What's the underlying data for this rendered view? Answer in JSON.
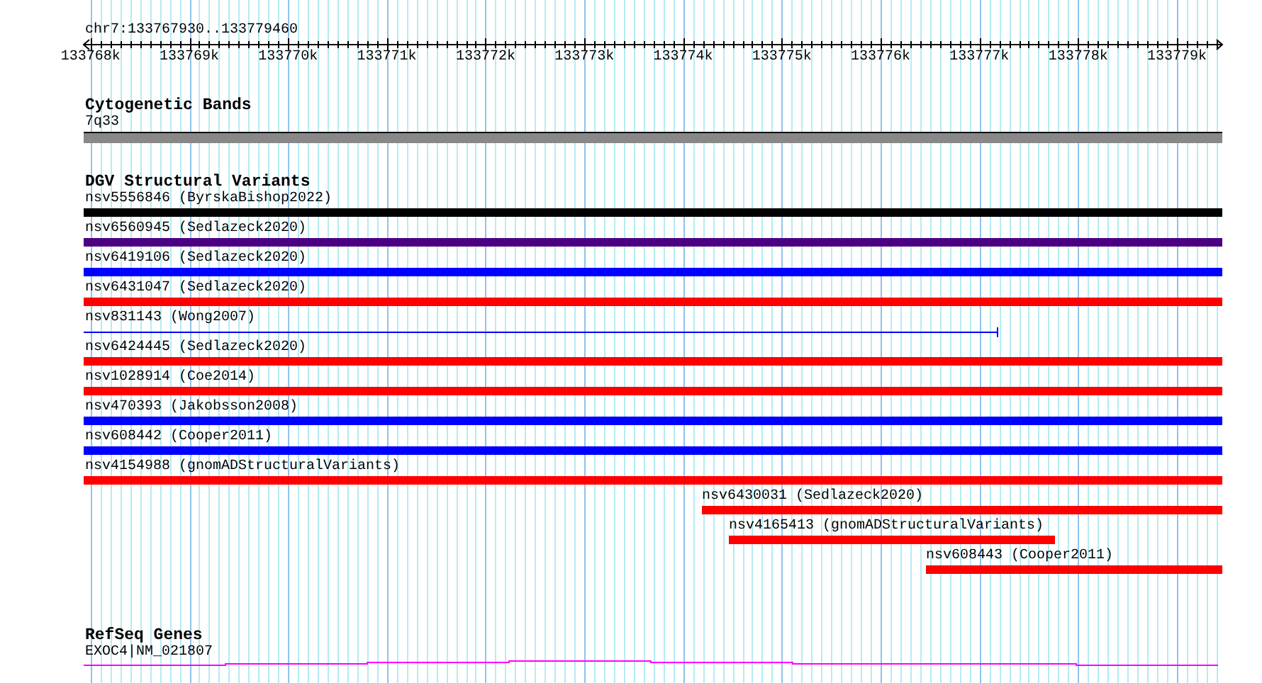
{
  "ruler": {
    "position": "chr7:133767930..133779460",
    "ticks": [
      "133768k",
      "133769k",
      "133770k",
      "133771k",
      "133772k",
      "133773k",
      "133774k",
      "133775k",
      "133776k",
      "133777k",
      "133778k",
      "133779k"
    ]
  },
  "tracks": [
    {
      "title": "Cytogenetic Bands",
      "features": [
        {
          "label": "7q33",
          "kind": "band",
          "color": "#888888"
        }
      ]
    },
    {
      "title": "DGV Structural Variants",
      "features": [
        {
          "label": "nsv5556846 (ByrskaBishop2022)",
          "kind": "bar",
          "color": "#000000"
        },
        {
          "label": "nsv6560945 (Sedlazeck2020)",
          "kind": "bar",
          "color": "#4b0082"
        },
        {
          "label": "nsv6419106 (Sedlazeck2020)",
          "kind": "bar",
          "color": "#0000ff"
        },
        {
          "label": "nsv6431047 (Sedlazeck2020)",
          "kind": "bar",
          "color": "#ff0000"
        },
        {
          "label": "nsv831143 (Wong2007)",
          "kind": "line",
          "color": "#0000ff"
        },
        {
          "label": "nsv6424445 (Sedlazeck2020)",
          "kind": "bar",
          "color": "#ff0000"
        },
        {
          "label": "nsv1028914 (Coe2014)",
          "kind": "bar",
          "color": "#ff0000"
        },
        {
          "label": "nsv470393 (Jakobsson2008)",
          "kind": "bar",
          "color": "#0000ff"
        },
        {
          "label": "nsv608442 (Cooper2011)",
          "kind": "bar",
          "color": "#0000ff"
        },
        {
          "label": "nsv4154988 (gnomADStructuralVariants)",
          "kind": "bar",
          "color": "#ff0000"
        },
        {
          "label": "nsv6430031 (Sedlazeck2020)",
          "kind": "bar",
          "color": "#ff0000"
        },
        {
          "label": "nsv4165413 (gnomADStructuralVariants)",
          "kind": "bar",
          "color": "#ff0000"
        },
        {
          "label": "nsv608443 (Cooper2011)",
          "kind": "bar",
          "color": "#ff0000"
        }
      ]
    },
    {
      "title": "RefSeq Genes",
      "features": [
        {
          "label": "EXOC4|NM_021807",
          "kind": "gene",
          "color": "#ff00ff"
        }
      ]
    }
  ]
}
